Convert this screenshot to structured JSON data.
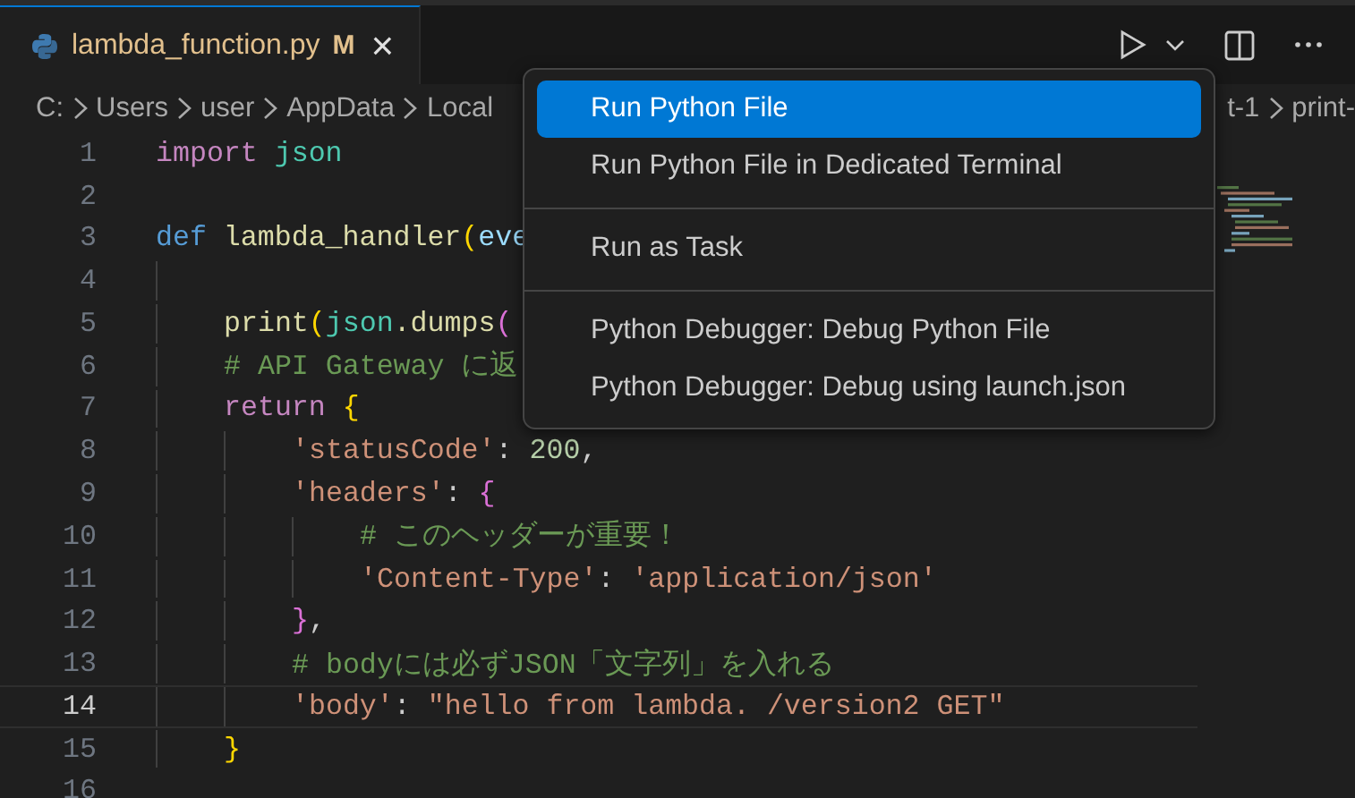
{
  "tab": {
    "file_name": "lambda_function.py",
    "status": "M",
    "close": "×",
    "selected": true
  },
  "breadcrumbs": [
    "C:",
    "Users",
    "user",
    "AppData",
    "Local"
  ],
  "breadcrumbs_right": [
    "t-1",
    "print-"
  ],
  "code": {
    "lines": [
      {
        "number": "1",
        "current": false,
        "tokens": [
          {
            "text": "import",
            "kind": "keyword"
          },
          {
            "text": " json",
            "kind": "module"
          }
        ]
      },
      {
        "number": "2",
        "current": false
      },
      {
        "number": "3",
        "current": false,
        "tokens": [
          {
            "text": "def",
            "kind": "storage"
          },
          {
            "text": " lambda_handler",
            "kind": "function"
          },
          {
            "text": "(",
            "kind": "bracket1"
          },
          {
            "text": "eve",
            "kind": "param"
          }
        ],
        "children": [
          {
            "number": "4",
            "current": false
          },
          {
            "number": "5",
            "current": false,
            "tokens": [
              {
                "text": "print",
                "kind": "function"
              },
              {
                "text": "(",
                "kind": "bracket1"
              },
              {
                "text": "json",
                "kind": "module"
              },
              {
                "text": ".dumps",
                "kind": "function"
              },
              {
                "text": "(",
                "kind": "bracket2"
              }
            ]
          },
          {
            "number": "6",
            "current": false,
            "tokens": [
              {
                "text": "# API Gateway に返",
                "kind": "comment"
              }
            ]
          },
          {
            "number": "7",
            "current": false,
            "tokens": [
              {
                "text": "return",
                "kind": "keyword"
              },
              {
                "text": " {",
                "kind": "bracket1"
              }
            ],
            "children": [
              {
                "number": "8",
                "current": false,
                "tokens": [
                  {
                    "text": "'statusCode'",
                    "kind": "string"
                  },
                  {
                    "text": ": ",
                    "kind": "plain"
                  },
                  {
                    "text": "200",
                    "kind": "number"
                  },
                  {
                    "text": ",",
                    "kind": "plain"
                  }
                ]
              },
              {
                "number": "9",
                "current": false,
                "tokens": [
                  {
                    "text": "'headers'",
                    "kind": "string"
                  },
                  {
                    "text": ": ",
                    "kind": "plain"
                  },
                  {
                    "text": "{",
                    "kind": "bracket2"
                  }
                ],
                "children": [
                  {
                    "number": "10",
                    "current": false,
                    "tokens": [
                      {
                        "text": "# このヘッダーが重要！",
                        "kind": "comment"
                      }
                    ]
                  },
                  {
                    "number": "11",
                    "current": false,
                    "tokens": [
                      {
                        "text": "'Content-Type'",
                        "kind": "string"
                      },
                      {
                        "text": ": ",
                        "kind": "plain"
                      },
                      {
                        "text": "'application/json'",
                        "kind": "string"
                      }
                    ]
                  }
                ]
              },
              {
                "number": "12",
                "current": false,
                "tokens": [
                  {
                    "text": "}",
                    "kind": "bracket2"
                  },
                  {
                    "text": ",",
                    "kind": "plain"
                  }
                ]
              },
              {
                "number": "13",
                "current": false,
                "tokens": [
                  {
                    "text": "# bodyには必ずJSON「文字列」を入れる",
                    "kind": "comment"
                  }
                ]
              },
              {
                "number": "14",
                "current": true,
                "tokens": [
                  {
                    "text": "'body'",
                    "kind": "string"
                  },
                  {
                    "text": ": ",
                    "kind": "plain"
                  },
                  {
                    "text": "\"hello from lambda. /version2 GET\"",
                    "kind": "string"
                  }
                ]
              }
            ]
          },
          {
            "number": "15",
            "current": false,
            "tokens": [
              {
                "text": "}",
                "kind": "bracket1"
              }
            ]
          }
        ]
      },
      {
        "number": "16",
        "current": false
      }
    ]
  },
  "run_menu": [
    {
      "kind": "item",
      "label": "Run Python File",
      "selected": true
    },
    {
      "kind": "item",
      "label": "Run Python File in Dedicated Terminal",
      "selected": false
    },
    {
      "kind": "separator"
    },
    {
      "kind": "item",
      "label": "Run as Task",
      "selected": false
    },
    {
      "kind": "separator"
    },
    {
      "kind": "item",
      "label": "Python Debugger: Debug Python File",
      "selected": false
    },
    {
      "kind": "item",
      "label": "Python Debugger: Debug using launch.json",
      "selected": false
    }
  ]
}
